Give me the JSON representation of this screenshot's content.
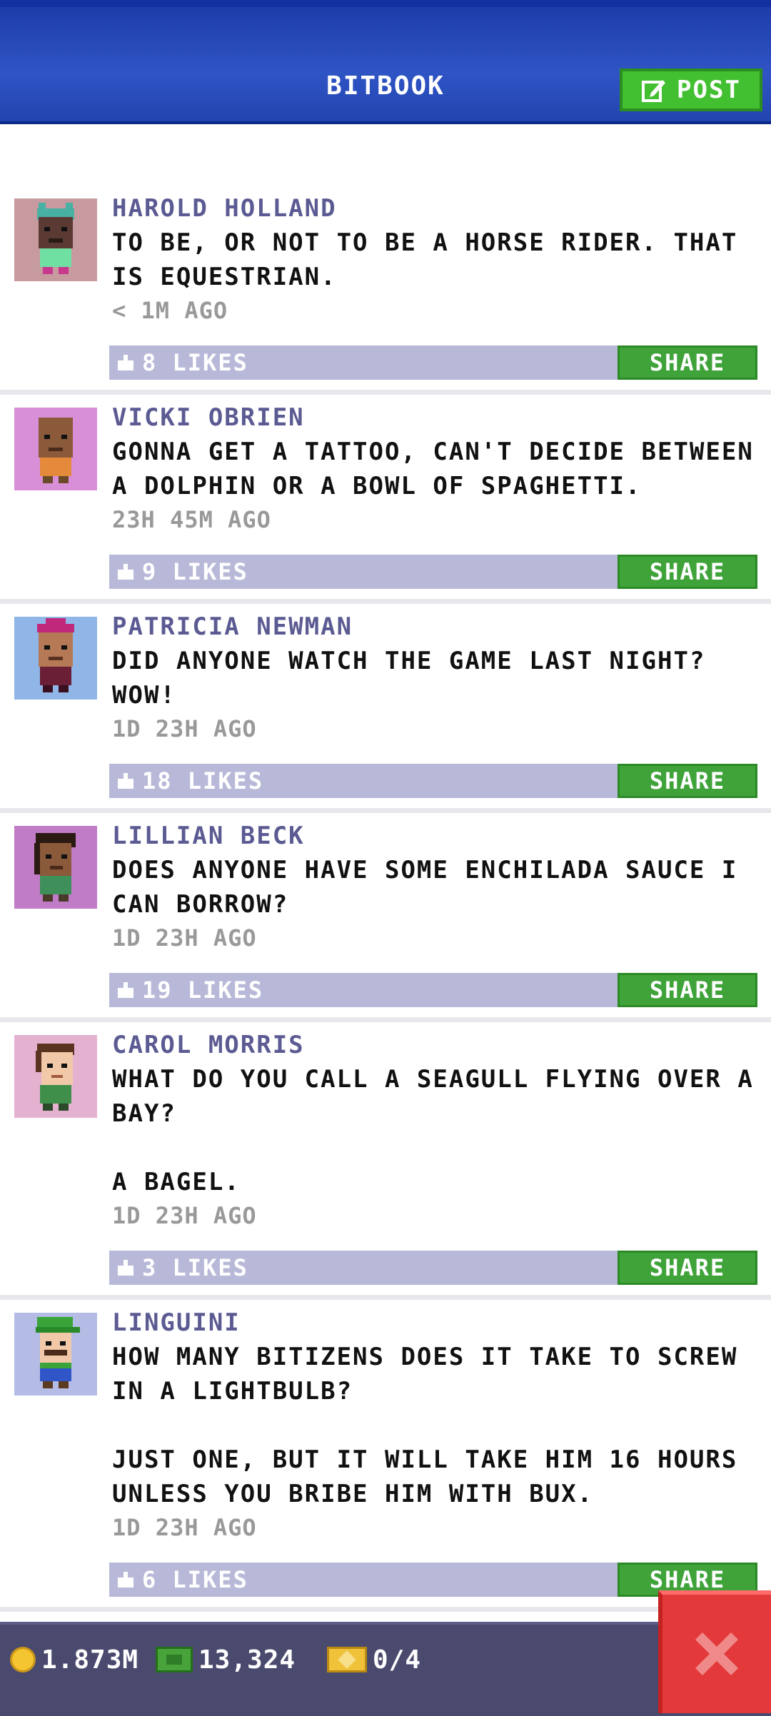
{
  "header": {
    "title": "BITBOOK",
    "post_label": "POST"
  },
  "posts": [
    {
      "name": "HAROLD HOLLAND",
      "text": "TO BE, OR NOT TO BE A HORSE RIDER. THAT IS EQUESTRIAN.",
      "time": "< 1M AGO",
      "likes": "8 LIKES",
      "share": "SHARE",
      "avatar_bg": "#c79aa0"
    },
    {
      "name": "VICKI OBRIEN",
      "text": "GONNA GET A TATTOO, CAN'T DECIDE BETWEEN A DOLPHIN OR A BOWL OF SPAGHETTI.",
      "time": "23H 45M AGO",
      "likes": "9 LIKES",
      "share": "SHARE",
      "avatar_bg": "#d98fd8"
    },
    {
      "name": "PATRICIA NEWMAN",
      "text": "DID ANYONE WATCH THE GAME LAST NIGHT? WOW!",
      "time": "1D 23H AGO",
      "likes": "18 LIKES",
      "share": "SHARE",
      "avatar_bg": "#8fb6e6"
    },
    {
      "name": "LILLIAN BECK",
      "text": "DOES ANYONE HAVE SOME ENCHILADA SAUCE I CAN BORROW?",
      "time": "1D 23H AGO",
      "likes": "19 LIKES",
      "share": "SHARE",
      "avatar_bg": "#c07cc6"
    },
    {
      "name": "CAROL MORRIS",
      "text": "WHAT DO YOU CALL A SEAGULL FLYING OVER A BAY?\n\nA BAGEL.",
      "time": "1D 23H AGO",
      "likes": "3 LIKES",
      "share": "SHARE",
      "avatar_bg": "#e4b2d0"
    },
    {
      "name": "LINGUINI",
      "text": "HOW MANY BITIZENS DOES IT TAKE TO SCREW IN A LIGHTBULB?\n\nJUST ONE, BUT IT WILL TAKE HIM 16 HOURS UNLESS YOU BRIBE HIM WITH BUX.",
      "time": "1D 23H AGO",
      "likes": "6 LIKES",
      "share": "SHARE",
      "avatar_bg": "#b4bce6"
    }
  ],
  "footer": {
    "coins": "1.873M",
    "bux": "13,324",
    "tickets": "0/4"
  },
  "colors": {
    "accent_blue": "#2f54c4",
    "post_green": "#43c031",
    "share_green": "#3fa33a",
    "like_bar": "#b8b9d8",
    "name_purple": "#5b5a92",
    "close_red": "#e4393a"
  }
}
